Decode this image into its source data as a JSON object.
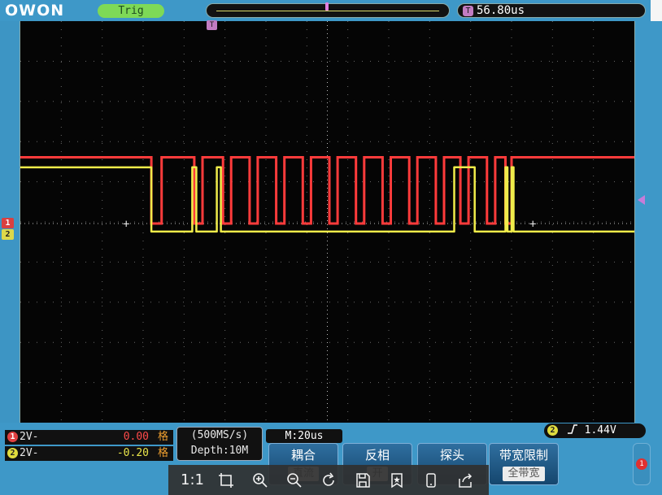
{
  "header": {
    "logo": "OWON",
    "trigger_status": "Trig",
    "time_icon": "T",
    "time_offset": "56.80us"
  },
  "markers": {
    "ch1": "1",
    "ch2": "2",
    "tpos": "T"
  },
  "channels": [
    {
      "badge": "1",
      "coupling": "2V-",
      "position": "0.00",
      "unit": "格",
      "color": "#ff4a4a"
    },
    {
      "badge": "2",
      "coupling": "2V-",
      "position": "-0.20",
      "unit": "格",
      "color": "#eae64a"
    }
  ],
  "acquisition": {
    "sample_rate": "(500MS/s)",
    "depth": "Depth:10M",
    "timebase": "M:20us"
  },
  "trigger": {
    "badge": "2",
    "slope_icon": "rising-edge-icon",
    "level": "1.44V"
  },
  "menu": [
    {
      "label": "耦合",
      "sub": "直流"
    },
    {
      "label": "反相",
      "sub": "开"
    },
    {
      "label": "探头",
      "sub": ""
    },
    {
      "label": "带宽限制",
      "sub": "全带宽"
    }
  ],
  "side_button": {
    "badge": "1"
  },
  "viewer_toolbar": {
    "actual_size": "1:1",
    "icons": [
      "crop-icon",
      "zoom-in-icon",
      "zoom-out-icon",
      "rotate-icon",
      "save-icon",
      "favorite-icon",
      "device-icon",
      "share-icon"
    ]
  },
  "colors": {
    "ch1_trace": "#ff3b3b",
    "ch2_trace": "#f0ec4a",
    "screen_bg": "#050505",
    "frame": "#3e98c8"
  },
  "waveform": {
    "time_per_div_us": 20,
    "volts_per_div": 2,
    "ch1_levels_div": {
      "high": 1.65,
      "low": 0.0
    },
    "ch2_levels_div": {
      "high": 1.4,
      "low": -0.2
    },
    "ch1_transitions_div": [
      3.2,
      3.45,
      4.25,
      4.45,
      4.95,
      5.15,
      5.6,
      5.8,
      6.25,
      6.45,
      6.9,
      7.1,
      7.55,
      7.75,
      8.2,
      8.4,
      8.85,
      9.05,
      9.5,
      9.7,
      10.15,
      10.35,
      10.75,
      10.95,
      11.4,
      11.6,
      11.85,
      12.0
    ],
    "ch2_transitions_div": [
      3.2,
      4.2,
      4.3,
      4.8,
      4.9,
      10.6,
      11.1,
      11.85,
      11.9,
      12.0,
      12.05
    ]
  }
}
